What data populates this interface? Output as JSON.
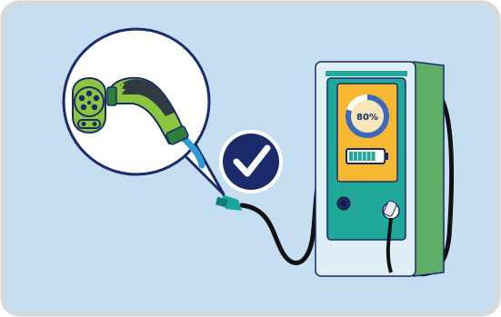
{
  "illustration": {
    "charge_level_label": "80%",
    "charge_fraction": 0.8,
    "battery_fraction": 0.8
  },
  "colors": {
    "panel_bg": "#c5dff0",
    "panel_border": "#d9d9d9",
    "navy": "#1b2a6b",
    "charger_body": "#dfeef7",
    "charger_side": "#5fae68",
    "charger_teal": "#20a99a",
    "screen_yellow": "#f6b731",
    "gauge_blue": "#3b68b8",
    "connector_green": "#8cc63f",
    "connector_dark": "#2f7d3a",
    "cable_blue": "#2f9bd6",
    "check_badge": "#1b2a6b"
  }
}
